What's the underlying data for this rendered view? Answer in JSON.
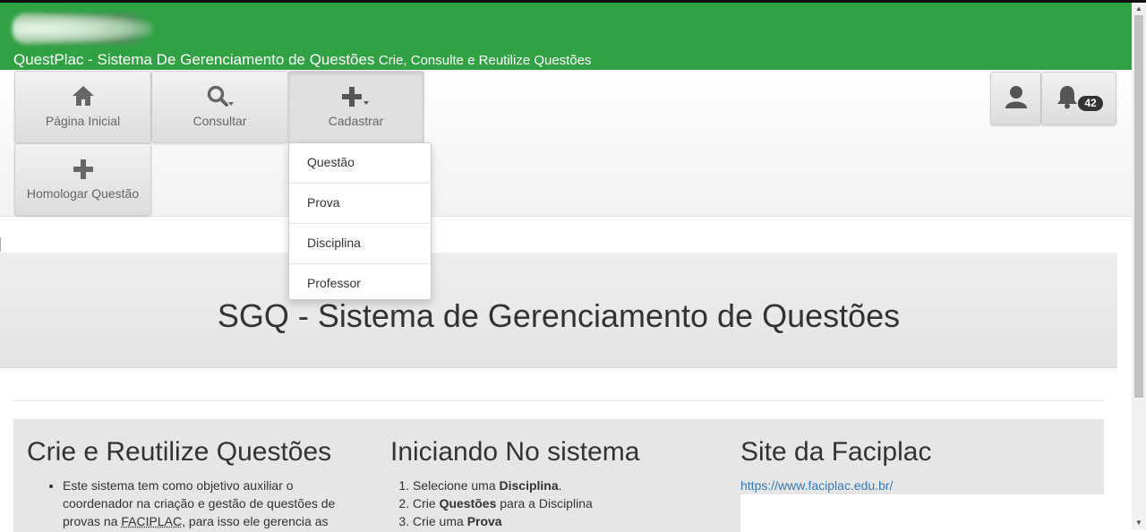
{
  "header": {
    "app_name": "QuestPlac - Sistema De Gerenciamento de Questões",
    "tagline": "Crie, Consulte e Reutilize Questões"
  },
  "nav": {
    "home_label": "Página Inicial",
    "search_label": "Consultar",
    "register_label": "Cadastrar",
    "approve_label": "Homologar Questão",
    "notifications_count": "42"
  },
  "dropdown": {
    "items": [
      "Questão",
      "Prova",
      "Disciplina",
      "Professor"
    ]
  },
  "jumbotron": {
    "title": "SGQ - Sistema de Gerenciamento de Questões"
  },
  "sections": {
    "create": {
      "title": "Crie e Reutilize Questões",
      "text_before": "Este sistema tem como objetivo auxiliar o coordenador na criação e gestão de questões de provas na ",
      "abbr": "FACIPLAC",
      "text_after": ", para isso ele gerencia as"
    },
    "start": {
      "title": "Iniciando No sistema",
      "steps": [
        {
          "pre": "Selecione uma ",
          "bold": "Disciplina",
          "post": "."
        },
        {
          "pre": "Crie ",
          "bold": "Questões",
          "post": " para a Disciplina"
        },
        {
          "pre": "Crie uma ",
          "bold": "Prova",
          "post": ""
        }
      ]
    },
    "site": {
      "title": "Site da Faciplac",
      "url": "https://www.faciplac.edu.br/"
    }
  },
  "colors": {
    "header_green": "#30a244",
    "link_blue": "#337ab7"
  }
}
